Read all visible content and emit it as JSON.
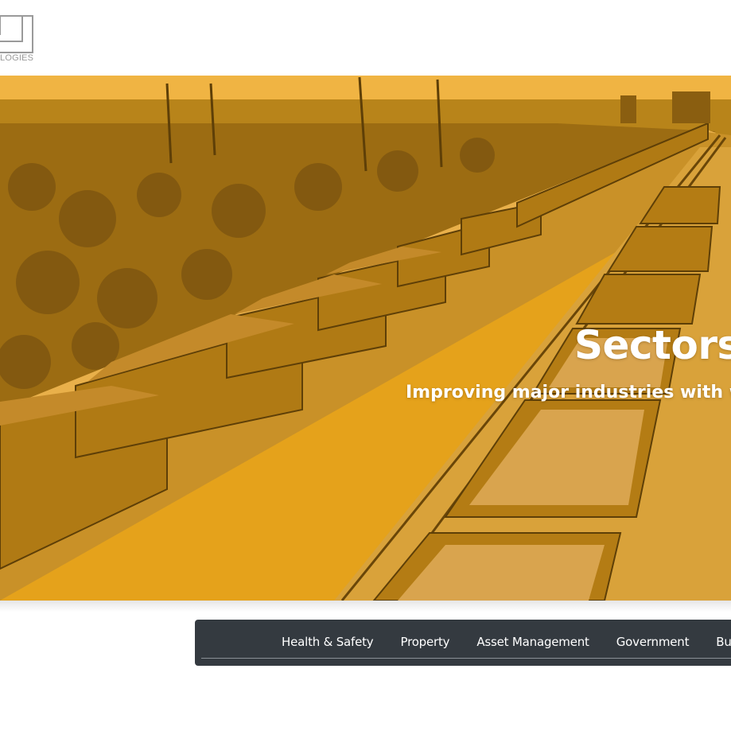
{
  "header": {
    "logo_text": "LOGIES"
  },
  "hero": {
    "title": "Sectors",
    "subtitle": "Improving major industries with world",
    "overlay_color": "#e5a21b",
    "image_subject": "ore-train-railway-photo"
  },
  "sector_nav": {
    "background": "#343a40",
    "items": [
      {
        "label": "Health & Safety"
      },
      {
        "label": "Property"
      },
      {
        "label": "Asset Management"
      },
      {
        "label": "Government"
      },
      {
        "label": "Business"
      }
    ]
  }
}
